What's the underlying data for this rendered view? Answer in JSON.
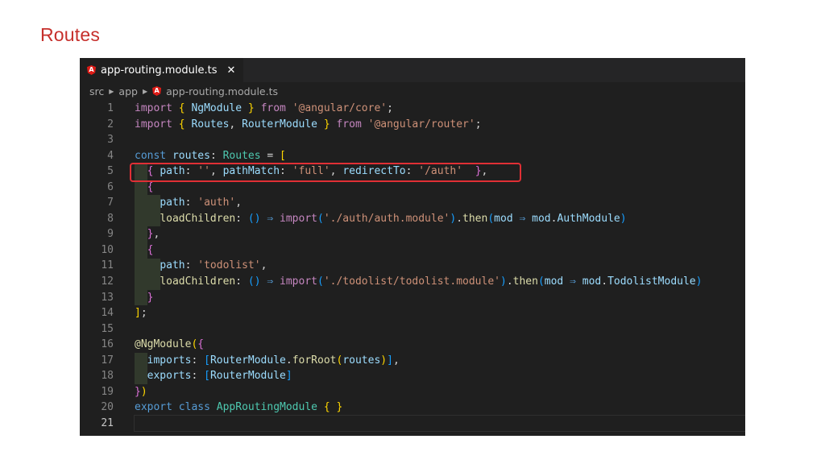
{
  "slide": {
    "title": "Routes"
  },
  "editor": {
    "tab": {
      "label": "app-routing.module.ts",
      "close": "✕"
    },
    "breadcrumb": [
      "src",
      "app",
      "app-routing.module.ts"
    ],
    "active_line": 21,
    "lines": [
      [
        [
          "kw2",
          "import "
        ],
        [
          "brace",
          "{ "
        ],
        [
          "ident",
          "NgModule "
        ],
        [
          "brace",
          "} "
        ],
        [
          "kw2",
          "from "
        ],
        [
          "str",
          "'@angular/core'"
        ],
        [
          "plain",
          ";"
        ]
      ],
      [
        [
          "kw2",
          "import "
        ],
        [
          "brace",
          "{ "
        ],
        [
          "ident",
          "Routes"
        ],
        [
          "plain",
          ", "
        ],
        [
          "ident",
          "RouterModule "
        ],
        [
          "brace",
          "} "
        ],
        [
          "kw2",
          "from "
        ],
        [
          "str",
          "'@angular/router'"
        ],
        [
          "plain",
          ";"
        ]
      ],
      [],
      [
        [
          "kw",
          "const "
        ],
        [
          "ident",
          "routes"
        ],
        [
          "plain",
          ": "
        ],
        [
          "type",
          "Routes "
        ],
        [
          "plain",
          "= "
        ],
        [
          "brace",
          "["
        ]
      ],
      [
        [
          "plain",
          "  "
        ],
        [
          "brace2",
          "{ "
        ],
        [
          "prop",
          "path"
        ],
        [
          "plain",
          ": "
        ],
        [
          "str",
          "''"
        ],
        [
          "plain",
          ", "
        ],
        [
          "prop",
          "pathMatch"
        ],
        [
          "plain",
          ": "
        ],
        [
          "str",
          "'full'"
        ],
        [
          "plain",
          ", "
        ],
        [
          "prop",
          "redirectTo"
        ],
        [
          "plain",
          ": "
        ],
        [
          "str",
          "'/auth'  "
        ],
        [
          "brace2",
          "}"
        ],
        [
          "plain",
          ","
        ]
      ],
      [
        [
          "plain",
          "  "
        ],
        [
          "brace2",
          "{"
        ]
      ],
      [
        [
          "plain",
          "    "
        ],
        [
          "prop",
          "path"
        ],
        [
          "plain",
          ": "
        ],
        [
          "str",
          "'auth'"
        ],
        [
          "plain",
          ","
        ]
      ],
      [
        [
          "plain",
          "    "
        ],
        [
          "fn",
          "loadChildren"
        ],
        [
          "plain",
          ": "
        ],
        [
          "brace3",
          "() "
        ],
        [
          "kw",
          "⇒ "
        ],
        [
          "kw2",
          "import"
        ],
        [
          "brace3",
          "("
        ],
        [
          "str",
          "'./auth/auth.module'"
        ],
        [
          "brace3",
          ")"
        ],
        [
          "plain",
          "."
        ],
        [
          "fn",
          "then"
        ],
        [
          "brace3",
          "("
        ],
        [
          "ident",
          "mod "
        ],
        [
          "kw",
          "⇒ "
        ],
        [
          "ident",
          "mod"
        ],
        [
          "plain",
          "."
        ],
        [
          "ident",
          "AuthModule"
        ],
        [
          "brace3",
          ")"
        ]
      ],
      [
        [
          "plain",
          "  "
        ],
        [
          "brace2",
          "}"
        ],
        [
          "plain",
          ","
        ]
      ],
      [
        [
          "plain",
          "  "
        ],
        [
          "brace2",
          "{"
        ]
      ],
      [
        [
          "plain",
          "    "
        ],
        [
          "prop",
          "path"
        ],
        [
          "plain",
          ": "
        ],
        [
          "str",
          "'todolist'"
        ],
        [
          "plain",
          ","
        ]
      ],
      [
        [
          "plain",
          "    "
        ],
        [
          "fn",
          "loadChildren"
        ],
        [
          "plain",
          ": "
        ],
        [
          "brace3",
          "() "
        ],
        [
          "kw",
          "⇒ "
        ],
        [
          "kw2",
          "import"
        ],
        [
          "brace3",
          "("
        ],
        [
          "str",
          "'./todolist/todolist.module'"
        ],
        [
          "brace3",
          ")"
        ],
        [
          "plain",
          "."
        ],
        [
          "fn",
          "then"
        ],
        [
          "brace3",
          "("
        ],
        [
          "ident",
          "mod "
        ],
        [
          "kw",
          "⇒ "
        ],
        [
          "ident",
          "mod"
        ],
        [
          "plain",
          "."
        ],
        [
          "ident",
          "TodolistModule"
        ],
        [
          "brace3",
          ")"
        ]
      ],
      [
        [
          "plain",
          "  "
        ],
        [
          "brace2",
          "}"
        ]
      ],
      [
        [
          "brace",
          "]"
        ],
        [
          "plain",
          ";"
        ]
      ],
      [],
      [
        [
          "fn",
          "@NgModule"
        ],
        [
          "brace",
          "("
        ],
        [
          "brace2",
          "{"
        ]
      ],
      [
        [
          "plain",
          "  "
        ],
        [
          "prop",
          "imports"
        ],
        [
          "plain",
          ": "
        ],
        [
          "brace3",
          "["
        ],
        [
          "ident",
          "RouterModule"
        ],
        [
          "plain",
          "."
        ],
        [
          "fn",
          "forRoot"
        ],
        [
          "brace",
          "("
        ],
        [
          "ident",
          "routes"
        ],
        [
          "brace",
          ")"
        ],
        [
          "brace3",
          "]"
        ],
        [
          "plain",
          ","
        ]
      ],
      [
        [
          "plain",
          "  "
        ],
        [
          "prop",
          "exports"
        ],
        [
          "plain",
          ": "
        ],
        [
          "brace3",
          "["
        ],
        [
          "ident",
          "RouterModule"
        ],
        [
          "brace3",
          "]"
        ]
      ],
      [
        [
          "brace2",
          "}"
        ],
        [
          "brace",
          ")"
        ]
      ],
      [
        [
          "kw",
          "export "
        ],
        [
          "kw",
          "class "
        ],
        [
          "type",
          "AppRoutingModule "
        ],
        [
          "brace",
          "{ "
        ],
        [
          "brace",
          "}"
        ]
      ],
      []
    ]
  },
  "colors": {
    "title": "#c62f2b",
    "editor_bg": "#1f1f1f",
    "highlight_box": "#e02f35",
    "angular_icon": "#dd1b16"
  }
}
